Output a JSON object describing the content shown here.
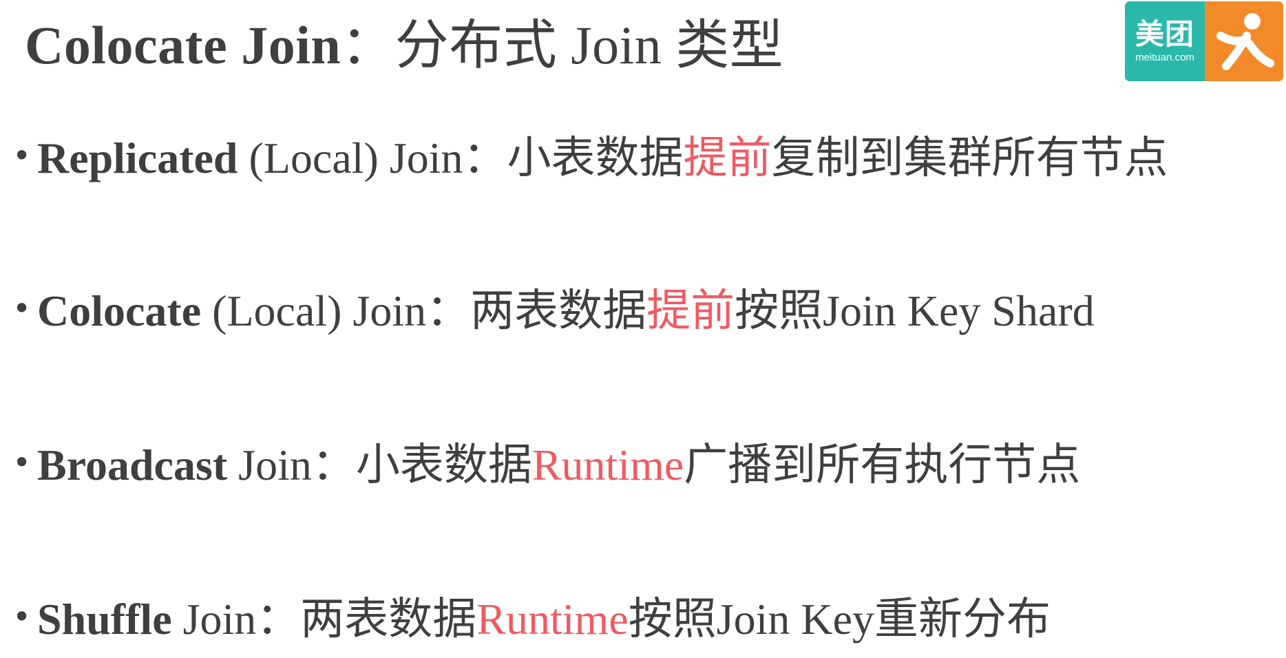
{
  "title": {
    "en": "Colocate Join",
    "cn": "：分布式 Join 类型"
  },
  "logo": {
    "brand_cn": "美团",
    "brand_en": "meituan.com",
    "colors": {
      "teal": "#29b8a9",
      "orange": "#f38a2a"
    },
    "icon": "dianping-person-icon"
  },
  "bullets": [
    {
      "bold": "Replicated",
      "rest": " (Local) Join：小表数据",
      "highlight": "提前",
      "tail": "复制到集群所有节点"
    },
    {
      "bold": "Colocate",
      "rest": " (Local) Join：两表数据",
      "highlight": "提前",
      "tail": "按照Join Key Shard"
    },
    {
      "bold": "Broadcast",
      "rest": " Join：小表数据",
      "highlight": "Runtime",
      "tail": "广播到所有执行节点"
    },
    {
      "bold": "Shuffle",
      "rest": " Join：两表数据",
      "highlight": "Runtime",
      "tail": "按照Join Key重新分布"
    }
  ],
  "colors": {
    "text": "#3f3f3f",
    "highlight": "#f05a62"
  }
}
